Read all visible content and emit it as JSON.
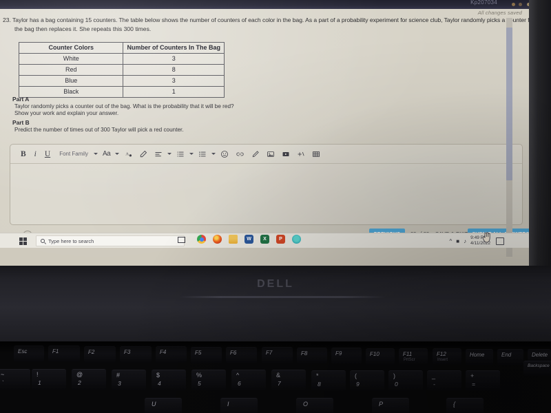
{
  "browser": {
    "tab_id_text": "Kp207034"
  },
  "page": {
    "saved_status": "All changes saved",
    "question_number": "23.",
    "question_line_1": "Taylor has a bag containing 15 counters.  The table below shows the number of counters of each color in the bag.  As a part of a probability experiment for science club, Taylor randomly picks a counter from",
    "question_line_2": "the bag then replaces it.  She repeats this 300 times."
  },
  "table": {
    "headers": [
      "Counter Colors",
      "Number of Counters In The Bag"
    ],
    "rows": [
      [
        "White",
        "3"
      ],
      [
        "Red",
        "8"
      ],
      [
        "Blue",
        "3"
      ],
      [
        "Black",
        "1"
      ]
    ]
  },
  "parts": {
    "part_a_label": "Part A",
    "part_a_line1": "Taylor randomly picks a counter out of the bag. What is the probability that it will be red?",
    "part_a_line2": "Show your work and explain your answer.",
    "part_b_label": "Part B",
    "part_b_line1": "Predict the number of times out of 300 Taylor will pick a red counter."
  },
  "editor": {
    "bold": "B",
    "italic": "i",
    "underline": "U",
    "font_family": "Font Family",
    "font_size": "Aa",
    "answer_text": ""
  },
  "footer": {
    "previous_label": "PREVIOUS",
    "page_counter": "23 of 23",
    "save_exit_label": "SAVE & EXIT",
    "submit_label": "SUBMIT ALL ANSWERS",
    "accent_color": "#4fa8d8"
  },
  "taskbar": {
    "search_placeholder": "Type here to search",
    "clock_time": "9:49 PM",
    "clock_date": "4/11/2022"
  },
  "laptop": {
    "brand": "DELL",
    "function_keys": [
      "Esc",
      "F1",
      "F2",
      "F3",
      "F4",
      "F5",
      "F6",
      "F7",
      "F8",
      "F9",
      "F10",
      "F11",
      "F12",
      "Home",
      "End",
      "Delete"
    ],
    "f11_sub": "PrtScr",
    "f12_sub": "Insert",
    "backspace_label": "Backspace",
    "number_row": [
      {
        "top": "~",
        "bottom": "`"
      },
      {
        "top": "!",
        "bottom": "1"
      },
      {
        "top": "@",
        "bottom": "2"
      },
      {
        "top": "#",
        "bottom": "3"
      },
      {
        "top": "$",
        "bottom": "4"
      },
      {
        "top": "%",
        "bottom": "5"
      },
      {
        "top": "^",
        "bottom": "6"
      },
      {
        "top": "&",
        "bottom": "7"
      },
      {
        "top": "*",
        "bottom": "8"
      },
      {
        "top": "(",
        "bottom": "9"
      },
      {
        "top": ")",
        "bottom": "0"
      },
      {
        "top": "_",
        "bottom": "-"
      },
      {
        "top": "+",
        "bottom": "="
      }
    ],
    "letter_row_partial": [
      "U",
      "I",
      "O",
      "P",
      "{"
    ]
  }
}
